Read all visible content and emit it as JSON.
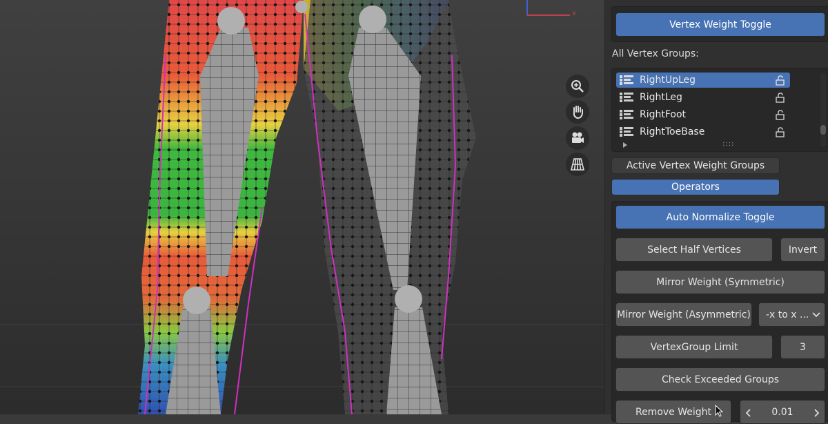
{
  "viewport": {
    "nav_icons": [
      "zoom-icon",
      "pan-hand-icon",
      "camera-icon",
      "perspective-grid-icon"
    ]
  },
  "panel": {
    "vertex_weight_toggle": "Vertex Weight Toggle",
    "all_vertex_groups_label": "All Vertex Groups:",
    "vertex_groups": [
      {
        "name": "RightUpLeg",
        "selected": true
      },
      {
        "name": "RightLeg",
        "selected": false
      },
      {
        "name": "RightFoot",
        "selected": false
      },
      {
        "name": "RightToeBase",
        "selected": false
      }
    ],
    "list_grip": "::::",
    "active_groups_tab": "Active Vertex Weight Groups",
    "operators_tab": "Operators",
    "auto_normalize": "Auto Normalize Toggle",
    "select_half": "Select Half Vertices",
    "invert": "Invert",
    "mirror_symmetric": "Mirror Weight (Symmetric)",
    "mirror_asymmetric": "Mirror Weight (Asymmetric)",
    "mirror_direction": "-x to x ...",
    "vertexgroup_limit": "VertexGroup Limit",
    "limit_value": "3",
    "check_exceeded": "Check Exceeded Groups",
    "remove_weight": "Remove Weight",
    "remove_value": "0.01"
  },
  "colors": {
    "accent": "#4772b3",
    "panel_bg": "#303030",
    "button_bg": "#545454"
  }
}
